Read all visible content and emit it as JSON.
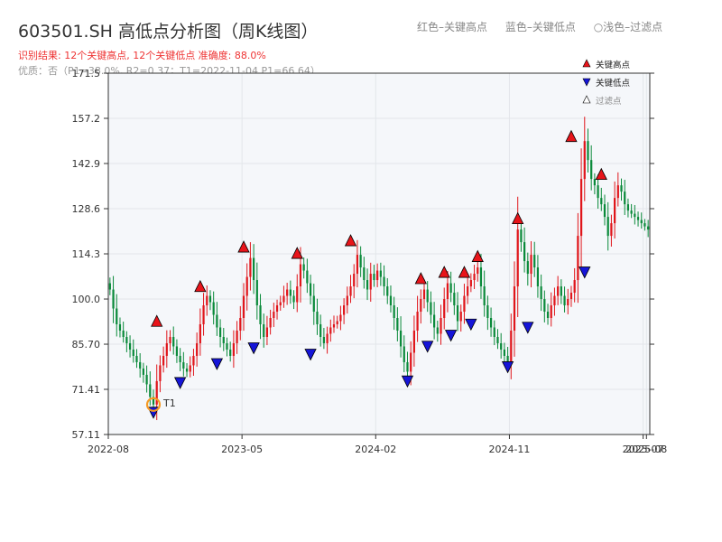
{
  "header": {
    "title": "603501.SH 高低点分析图（周K线图）",
    "summary": "识别结果: 12个关键高点, 12个关键低点  准确度: 88.0%",
    "quality": "优质：否（P1=38.0%, R2=0.37；T1=2022-11-04 P1=66.64）",
    "legend_top": [
      "红色–关键高点",
      "蓝色–关键低点",
      "○浅色–过滤点"
    ]
  },
  "legend": {
    "high": "关键高点",
    "low": "关键低点",
    "filtered": "过滤点"
  },
  "colors": {
    "up": "#e0161b",
    "down": "#0a8a3a",
    "high_marker": "#e8141a",
    "low_marker": "#1515d8",
    "t1_ring": "#f59a23",
    "plot_bg": "#f5f7fa"
  },
  "chart_data": {
    "type": "candlestick",
    "title": "603501.SH 高低点分析图（周K线图）",
    "y_ticks": [
      "57.11",
      "71.41",
      "85.70",
      "100.0",
      "114.3",
      "128.6",
      "142.9",
      "157.2",
      "171.5"
    ],
    "ylim": [
      57.11,
      171.5
    ],
    "x_ticks": [
      {
        "label": "2022-08",
        "index": 0
      },
      {
        "label": "2023-05",
        "index": 40
      },
      {
        "label": "2024-02",
        "index": 80
      },
      {
        "label": "2024-11",
        "index": 120
      },
      {
        "label": "2025-07",
        "index": 160
      },
      {
        "label": "2025-08",
        "index": 161
      }
    ],
    "grid": true,
    "closes": [
      103,
      97,
      92,
      90,
      88,
      86,
      84,
      82,
      80,
      78,
      76,
      73,
      69,
      66.6,
      74,
      79,
      82,
      86,
      88,
      85,
      82,
      80,
      78,
      77,
      79,
      82,
      86,
      92,
      98,
      101,
      99,
      95,
      91,
      88,
      86,
      84,
      82,
      86,
      90,
      94,
      101,
      107,
      113,
      106,
      98,
      92,
      88,
      91,
      94,
      96,
      98,
      99,
      101,
      103,
      101,
      99,
      104,
      111,
      109,
      105,
      101,
      96,
      92,
      88,
      86,
      89,
      91,
      92,
      93,
      95,
      98,
      101,
      104,
      108,
      114,
      110,
      106,
      103,
      108,
      106,
      109,
      107,
      104,
      101,
      98,
      94,
      90,
      85,
      80,
      77,
      83,
      90,
      96,
      100,
      103,
      99,
      95,
      91,
      89,
      94,
      100,
      105,
      102,
      98,
      93,
      96,
      101,
      104,
      106,
      108,
      110,
      104,
      98,
      94,
      91,
      88,
      86,
      84,
      82,
      80,
      90,
      104,
      122,
      118,
      112,
      108,
      114,
      110,
      104,
      100,
      96,
      94,
      98,
      101,
      104,
      101,
      98,
      100,
      102,
      106,
      120,
      138,
      150,
      144,
      138,
      136,
      132,
      130,
      126,
      120,
      124,
      132,
      136,
      134,
      130,
      128,
      127,
      126,
      125,
      124,
      123,
      122
    ],
    "key_highs": [
      {
        "index": 14,
        "value": 90.5
      },
      {
        "index": 27,
        "value": 101.5
      },
      {
        "index": 40,
        "value": 114
      },
      {
        "index": 56,
        "value": 112
      },
      {
        "index": 72,
        "value": 116
      },
      {
        "index": 93,
        "value": 104
      },
      {
        "index": 100,
        "value": 106
      },
      {
        "index": 106,
        "value": 106
      },
      {
        "index": 110,
        "value": 111
      },
      {
        "index": 122,
        "value": 123
      },
      {
        "index": 138,
        "value": 149
      },
      {
        "index": 147,
        "value": 137
      }
    ],
    "key_lows": [
      {
        "index": 13,
        "value": 66.6
      },
      {
        "index": 21,
        "value": 76
      },
      {
        "index": 32,
        "value": 82
      },
      {
        "index": 43,
        "value": 87
      },
      {
        "index": 60,
        "value": 85
      },
      {
        "index": 89,
        "value": 76.5
      },
      {
        "index": 95,
        "value": 87.5
      },
      {
        "index": 102,
        "value": 91
      },
      {
        "index": 108,
        "value": 94.5
      },
      {
        "index": 119,
        "value": 81
      },
      {
        "index": 125,
        "value": 93.5
      },
      {
        "index": 142,
        "value": 111
      }
    ],
    "t1": {
      "index": 13,
      "value": 66.6,
      "label": "T1"
    }
  }
}
